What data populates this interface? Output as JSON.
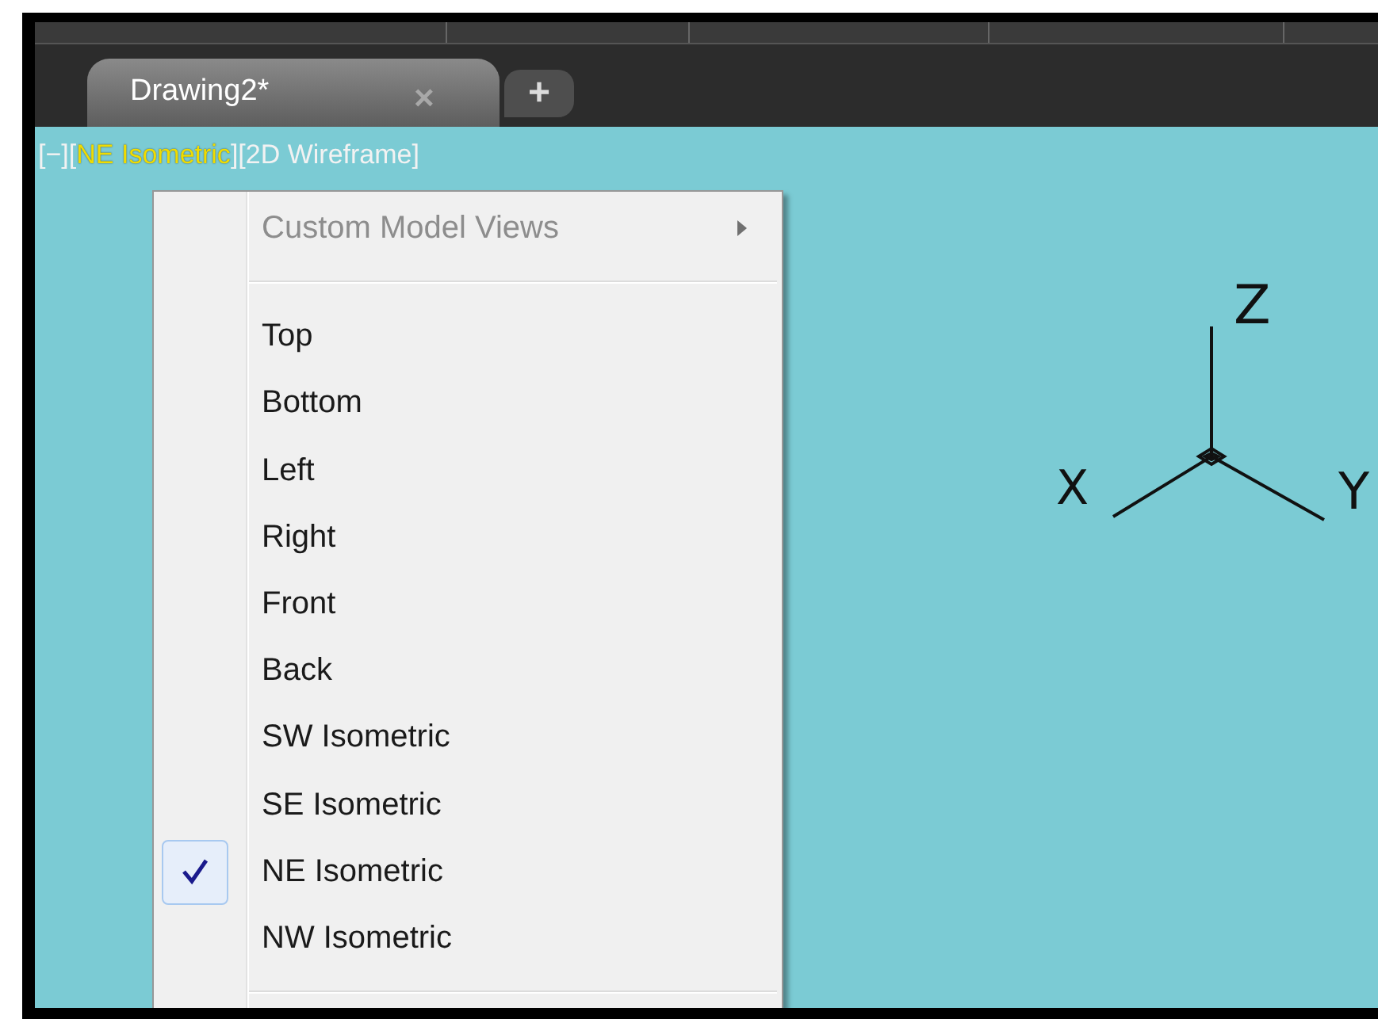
{
  "tabs": [
    {
      "label": "Drawing2*",
      "selected": true,
      "close": "×"
    }
  ],
  "new_tab": "+",
  "viewport_controls": [
    {
      "open": "[",
      "label": "−",
      "close": "]",
      "highlighted": false
    },
    {
      "open": "[",
      "label": "NE Isometric",
      "close": "]",
      "highlighted": true
    },
    {
      "open": "[",
      "label": "2D Wireframe",
      "close": "]",
      "highlighted": false
    }
  ],
  "ucs_icon": {
    "x": "X",
    "y": "Y",
    "z": "Z"
  },
  "context_menu": {
    "items": [
      {
        "kind": "submenu",
        "label": "Custom Model Views",
        "disabled": true,
        "checked": false
      },
      {
        "kind": "separator"
      },
      {
        "kind": "item",
        "label": "Top",
        "disabled": false,
        "checked": false
      },
      {
        "kind": "item",
        "label": "Bottom",
        "disabled": false,
        "checked": false
      },
      {
        "kind": "item",
        "label": "Left",
        "disabled": false,
        "checked": false
      },
      {
        "kind": "item",
        "label": "Right",
        "disabled": false,
        "checked": false
      },
      {
        "kind": "item",
        "label": "Front",
        "disabled": false,
        "checked": false
      },
      {
        "kind": "item",
        "label": "Back",
        "disabled": false,
        "checked": false
      },
      {
        "kind": "item",
        "label": "SW Isometric",
        "disabled": false,
        "checked": false
      },
      {
        "kind": "item",
        "label": "SE Isometric",
        "disabled": false,
        "checked": false
      },
      {
        "kind": "item",
        "label": "NE Isometric",
        "disabled": false,
        "checked": true
      },
      {
        "kind": "item",
        "label": "NW Isometric",
        "disabled": false,
        "checked": false
      },
      {
        "kind": "separator"
      }
    ]
  }
}
